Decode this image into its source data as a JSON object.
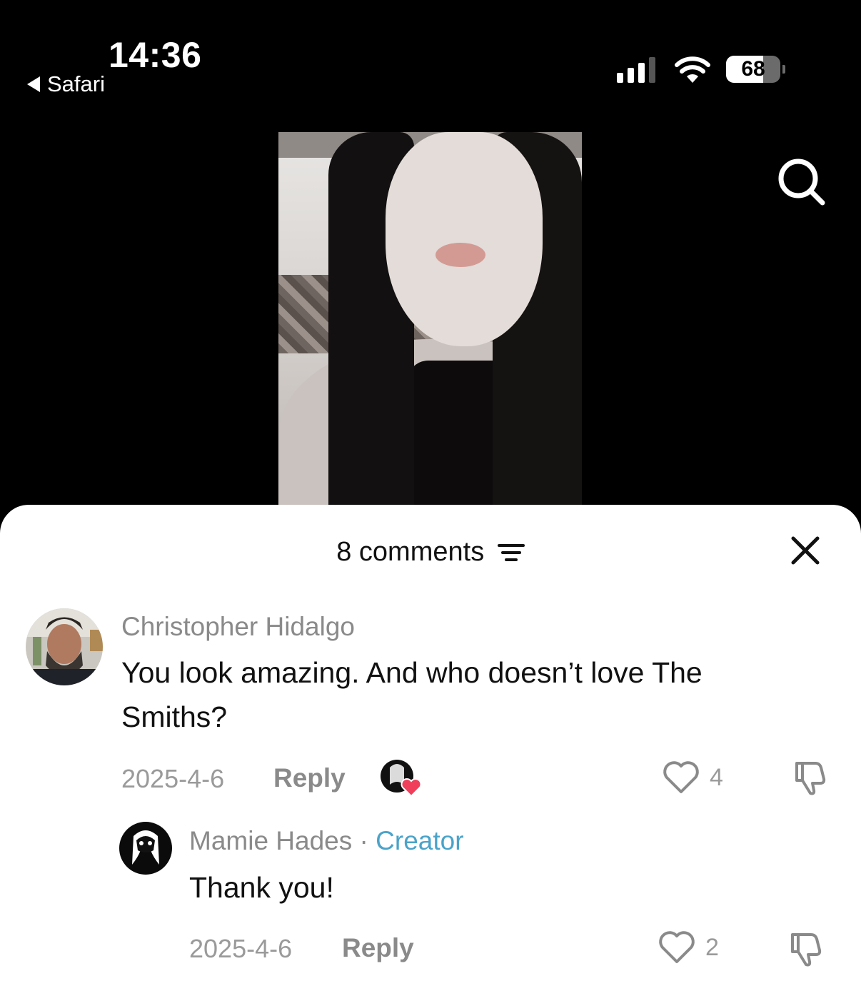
{
  "status_bar": {
    "time": "14:36",
    "back_app": "Safari",
    "battery": "68",
    "battery_level": 0.68
  },
  "video": {
    "search_icon": "search-icon"
  },
  "comments_sheet": {
    "title": "8 comments",
    "filter_icon": "filter-icon",
    "close_icon": "close-icon",
    "comments": [
      {
        "author": "Christopher Hidalgo",
        "text_line1": "You look amazing. And who doesn’t love The",
        "text_line2": "Smiths?",
        "date": "2025-4-6",
        "reply_label": "Reply",
        "likes": "4",
        "creator_liked": true
      },
      {
        "author": "Mamie Hades",
        "separator": "·",
        "badge": "Creator",
        "text": "Thank you!",
        "date": "2025-4-6",
        "reply_label": "Reply",
        "likes": "2"
      }
    ]
  },
  "colors": {
    "background_top": "#000000",
    "sheet": "#ffffff",
    "creator_badge": "#4aa3c9",
    "like_heart": "#ef3f5b"
  }
}
